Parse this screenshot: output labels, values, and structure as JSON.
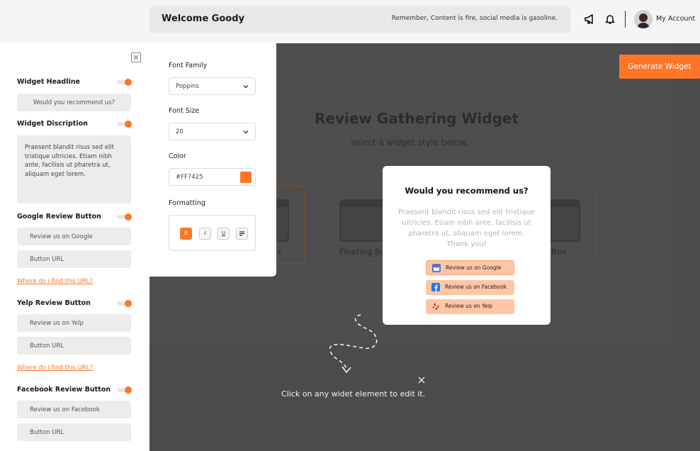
{
  "header": {
    "welcome": "Welcome Goody",
    "tagline": "Remember, Content is fire, social media is gasoline.",
    "account_label": "My Account"
  },
  "sidebar": {
    "sections": [
      {
        "label": "Widget Headline",
        "value": "Would you recommend us?"
      },
      {
        "label": "Widget Discription",
        "value": "Praesent blandit risus sed elit tristique ultricies. Etiam nibh ante, facilisis ut pharetra ut, aliquam eget lorem."
      },
      {
        "label": "Google Review Button",
        "button_text": "Review us on Google",
        "url_placeholder": "Button URL",
        "help_link": "Where do i find this URL?"
      },
      {
        "label": "Yelp Review Button",
        "button_text": "Review us on Yelp",
        "url_placeholder": "Button URL",
        "help_link": "Where do i find this URL?"
      },
      {
        "label": "Facebook Review Button",
        "button_text": "Review us on Facebook",
        "url_placeholder": "Button URL"
      }
    ]
  },
  "format_panel": {
    "font_family_label": "Font Family",
    "font_family_value": "Poppins",
    "font_size_label": "Font Size",
    "font_size_value": "20",
    "color_label": "Color",
    "color_value": "#FF7425",
    "formatting_label": "Formatting",
    "format_buttons": [
      "B",
      "I",
      "U"
    ]
  },
  "main": {
    "generate_button": "Generate Widget",
    "title": "Review Gathering Widget",
    "subtitle": "select a widget style below.",
    "style_cards": [
      "r",
      "Floating Bo",
      "Box"
    ],
    "hint": "Click on any widet element to edit it."
  },
  "popup": {
    "title": "Would you recommend us?",
    "description": "Praesent blandit risus sed elit tristique ultricies. Etiam nibh ante, facilisis ut pharetra ut, aliquam eget lorem. Thank you!",
    "buttons": [
      {
        "label": "Review us on Google",
        "icon": "google-business-icon"
      },
      {
        "label": "Review us on Facebook",
        "icon": "facebook-icon"
      },
      {
        "label": "Review us on Yelp",
        "icon": "yelp-icon"
      }
    ]
  },
  "colors": {
    "accent": "#FF7425",
    "overlay": "#4B4B4B",
    "button_fill": "#FFC6A6"
  }
}
